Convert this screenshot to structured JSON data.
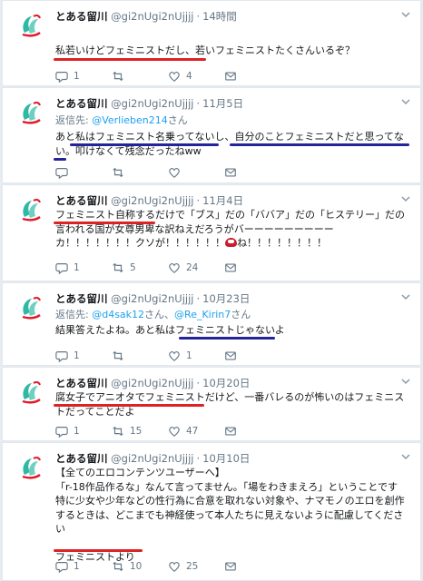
{
  "tweets": [
    {
      "name": "とある留川",
      "handle": "@gi2nUgi2nUjjjj",
      "time": "14時間",
      "text": "私若いけどフェミニストだし、若いフェミニストたくさんいるぞ？",
      "actions": {
        "reply": "1",
        "retweet": "",
        "like": "4",
        "dm": ""
      }
    },
    {
      "name": "とある留川",
      "handle": "@gi2nUgi2nUjjjj",
      "time": "11月5日",
      "reply_to": {
        "prefix": "返信先:",
        "user": "@Verlieben214",
        "suffix": "さん"
      },
      "text": "あと私はフェミニスト名乗ってないし、自分のことフェミニストだと思ってない。叩けなくて残念だったねww",
      "actions": {
        "reply": "",
        "retweet": "",
        "like": "",
        "dm": ""
      }
    },
    {
      "name": "とある留川",
      "handle": "@gi2nUgi2nUjjjj",
      "time": "11月4日",
      "text_a": "フェミニスト自称するだけで「ブス」だの「ババア」だの「ヒステリー」だの言われる国が女尊男卑な訳ねえだろうがバーーーーーーーーーカ！！！！！！！クソが！！！！！！",
      "text_b": "ね！！！！！！！！",
      "actions": {
        "reply": "1",
        "retweet": "5",
        "like": "24",
        "dm": ""
      }
    },
    {
      "name": "とある留川",
      "handle": "@gi2nUgi2nUjjjj",
      "time": "10月23日",
      "reply_to": {
        "prefix": "返信先:",
        "user": "@d4sak12",
        "mid": "さん、",
        "user2": "@Re_Kirin7",
        "suffix": "さん"
      },
      "text": "結果答えたよね。あと私はフェミニストじゃないよ",
      "actions": {
        "reply": "1",
        "retweet": "",
        "like": "1",
        "dm": ""
      }
    },
    {
      "name": "とある留川",
      "handle": "@gi2nUgi2nUjjjj",
      "time": "10月20日",
      "text": "腐女子でアニオタでフェミニストだけど、一番バレるのが怖いのはフェミニストだってことだよ",
      "actions": {
        "reply": "1",
        "retweet": "15",
        "like": "47",
        "dm": ""
      }
    },
    {
      "name": "とある留川",
      "handle": "@gi2nUgi2nUjjjj",
      "time": "10月10日",
      "text": "【全てのエロコンテンツユーザーへ】\n「r-18作品作るな」なんて言ってません。「場をわきまえろ」ということです\n特に少女や少年などの性行為に合意を取れない対象や、ナマモノのエロを創作するときは、どこまでも神経使って本人たちに見えないように配慮してください\n\nフェミニストより",
      "actions": {
        "reply": "1",
        "retweet": "10",
        "like": "25",
        "dm": ""
      }
    }
  ]
}
